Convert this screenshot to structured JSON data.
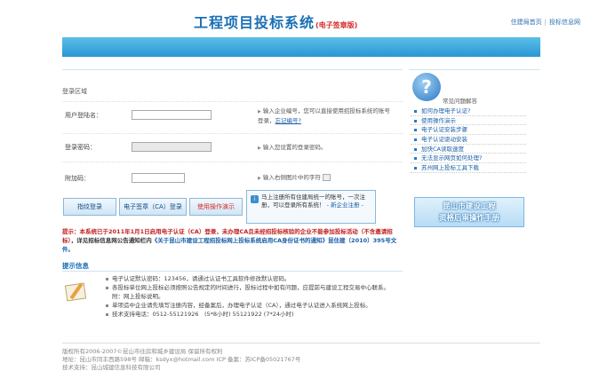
{
  "header": {
    "title": "工程项目投标系统",
    "subtitle": "(电子签章版)",
    "links": [
      "住建局首页",
      "投标信息网"
    ]
  },
  "login": {
    "area_title": "登录区域",
    "username_label": "用户登陆名：",
    "username_hint": "输入企业编号，您可以直接使用招投标系统的账号登录，",
    "username_link": "忘记编号?",
    "password_label": "登录密码：",
    "password_hint": "输入您设置的登录密码。",
    "captcha_label": "附加码：",
    "captcha_hint": "输入右侧图片中的字符",
    "buttons": [
      "指纹登录",
      "电子签章（CA）登录",
      "使用操作演示"
    ]
  },
  "tip": {
    "text": "马上注册所有住建局统一的账号，一次注册，可以登录所有系统！",
    "link": "- 新企业注册 -"
  },
  "notice": {
    "p1": "提示：本系统已于2011年1月1日启用电子认证（CA）登录，未办理CA且未经招投标核验的企业不能参加投标活动（不含邀请招标）",
    "p2": "，详见招标信息网公告通知栏内",
    "p3": "《关于昆山市建设工程招投标网上投标系统启用CA身份证书的通知》昆住建（2010）395号文件。"
  },
  "info": {
    "title": "提示信息",
    "items": [
      "电子认证默认密码：123456，请通过认证书工具软件修改默认密码。",
      "各投标单位网上投标必须按照公告规定的时间进行，投标过程中如有问题，应提前与建设工程交易中心联系。附：网上投标说明。",
      "单项造中企业请先填写注册内容，经备案后，办理电子认证（CA），通过电子认证进入系统网上投标。",
      "技术支持电话：0512-55121926　(5*8小时) 55121922 (7*24小时)"
    ]
  },
  "sidebar": {
    "title": "常见问题解答",
    "items": [
      "如何办理电子认证?",
      "使用操作演示",
      "电子认证安装步骤",
      "电子认证驱动安装",
      "加快CA读取速度",
      "无法显示网页如何处理?",
      "苏州网上投标工具下载"
    ],
    "banner_line1": "昆山市建设工程",
    "banner_line2": "资格后审操作手册"
  },
  "footer": {
    "line1": "版权所有2006-2007©昆山市住房和城乡建设局 保留所有权利",
    "line2": "地址：昆山市同丰西路598号 邮箱：ksdyx@hotmail.com ICP 备案：苏ICP备05021767号",
    "line3": "技术支持：昆山城建信息科技有限公司"
  }
}
